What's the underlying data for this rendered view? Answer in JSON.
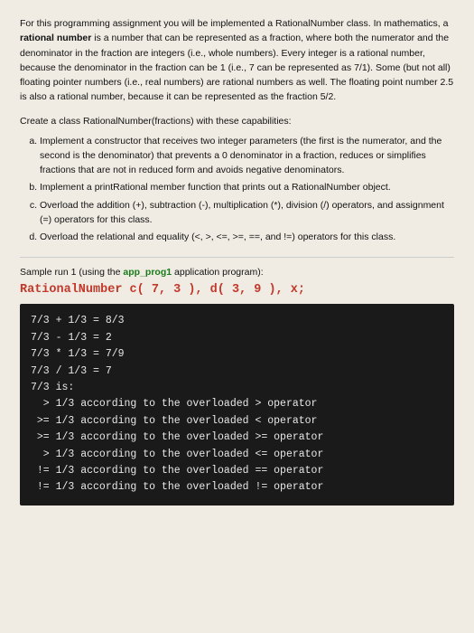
{
  "page": {
    "intro": {
      "paragraph": "For this programming assignment you will be implemented a RationalNumber class. In mathematics, a rational number is a number that can be represented as a fraction, where both the numerator and the denominator in the fraction are integers (i.e., whole numbers). Every integer is a rational number, because the denominator in the fraction can be 1 (i.e., 7 can be represented as 7/1). Some (but not all) floating pointer numbers (i.e., real numbers) are rational numbers as well. The floating point number 2.5 is also a rational number, because it can be represented as the fraction 5/2.",
      "bold_phrase": "rational number"
    },
    "capabilities": {
      "title": "Create a class RationalNumber(fractions) with these capabilities:",
      "items": [
        "Implement a constructor that receives two integer parameters (the first is the numerator, and the second is the denominator) that prevents a 0 denominator in a fraction, reduces or simplifies fractions that are not in reduced form and avoids negative denominators.",
        "Implement a printRational member function that prints out a RationalNumber object.",
        "Overload the addition (+), subtraction (-), multiplication (*), division (/) operators, and assignment (=) operators for this class.",
        "Overload the relational and equality (<, >, <=, >=, ==, and !=) operators for this class."
      ]
    },
    "sample": {
      "label": "Sample run 1 (using the ",
      "app_prog": "app_prog1",
      "label_end": " application program):",
      "constructor": "RationalNumber c( 7, 3 ), d( 3, 9 ), x;",
      "terminal_lines": [
        "7/3 + 1/3 = 8/3",
        "7/3 - 1/3 = 2",
        "7/3 * 1/3 = 7/9",
        "7/3 / 1/3 = 7",
        "7/3 is:",
        "  > 1/3 according to the overloaded > operator",
        " >= 1/3 according to the overloaded < operator",
        " >= 1/3 according to the overloaded >= operator",
        "  > 1/3 according to the overloaded <= operator",
        " != 1/3 according to the overloaded == operator",
        " != 1/3 according to the overloaded != operator"
      ]
    }
  }
}
